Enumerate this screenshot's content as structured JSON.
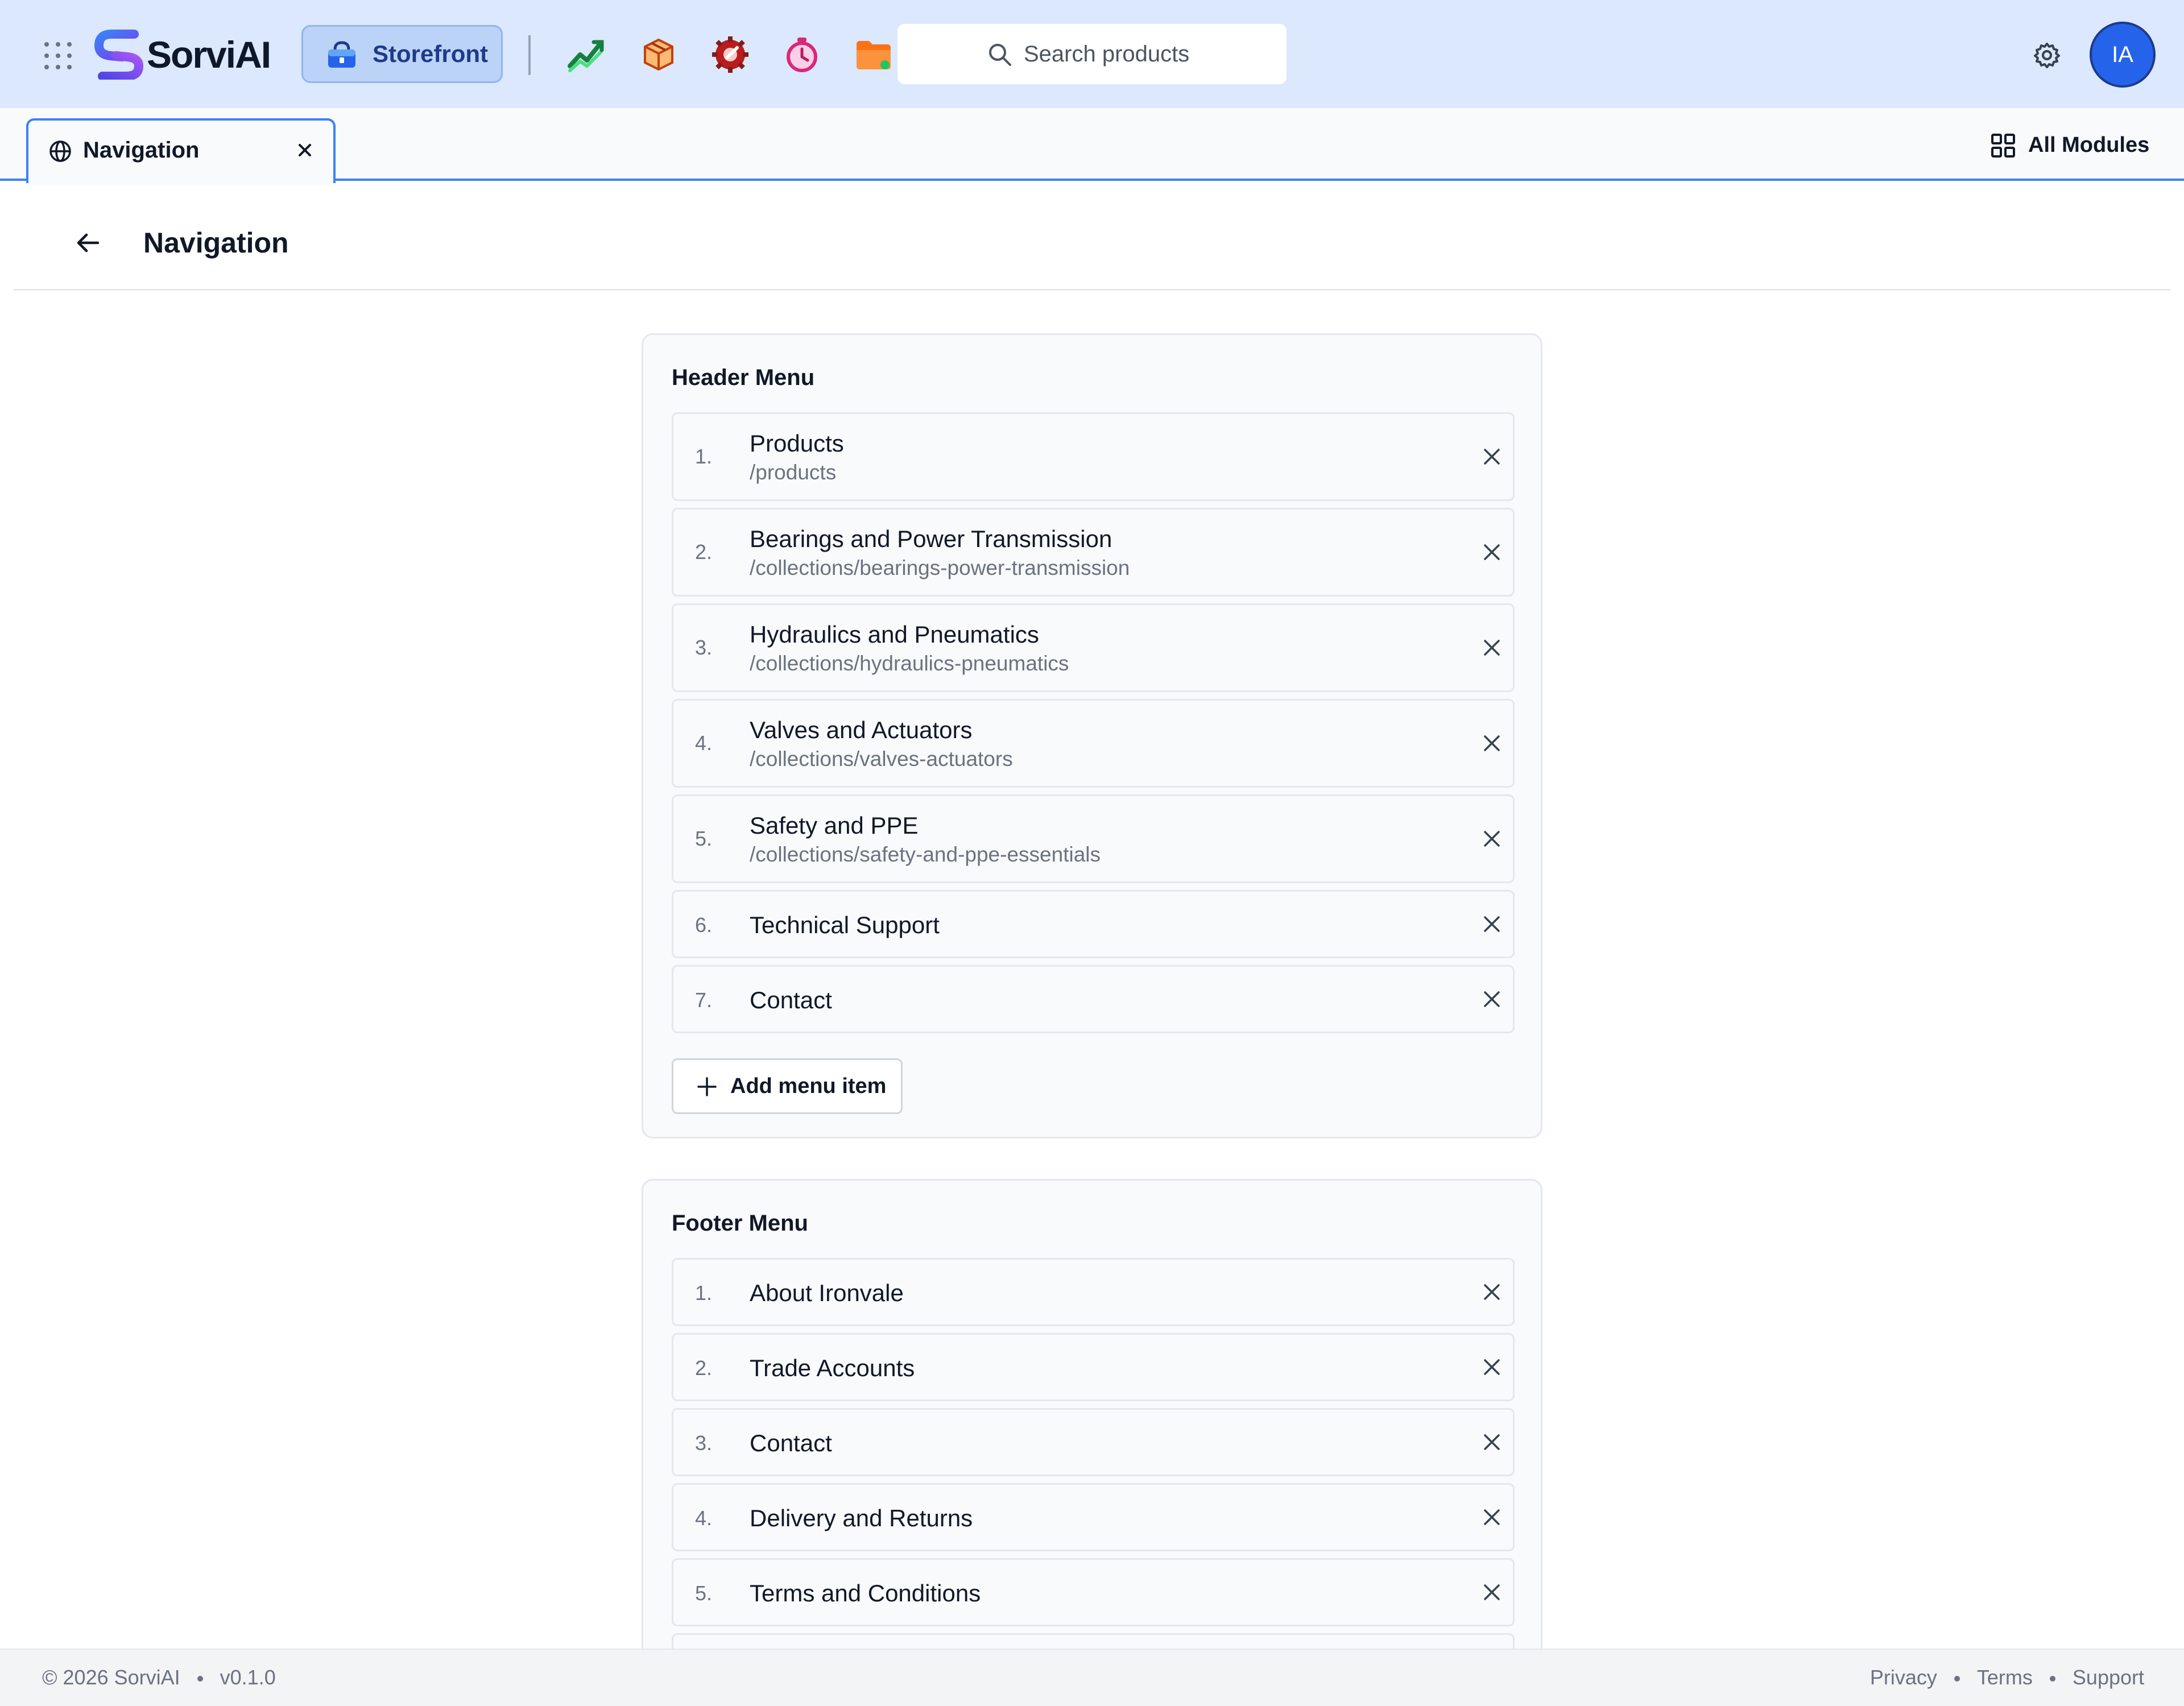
{
  "topbar": {
    "brand": "SorviAI",
    "active_module": "Storefront",
    "module_icons": [
      "analytics-icon",
      "orders-box-icon",
      "service-tools-icon",
      "timer-icon",
      "folder-icon"
    ],
    "search_placeholder": "Search products",
    "avatar_initials": "IA",
    "colors": {
      "bar_bg": "#dbe8fd",
      "avatar_bg": "#2563eb",
      "pill_bg": "#bcd3f8"
    }
  },
  "tabs": {
    "active_label": "Navigation",
    "all_modules_label": "All Modules"
  },
  "page": {
    "title": "Navigation"
  },
  "header_menu": {
    "title": "Header Menu",
    "items": [
      {
        "num": "1.",
        "title": "Products",
        "url": "/products"
      },
      {
        "num": "2.",
        "title": "Bearings and Power Transmission",
        "url": "/collections/bearings-power-transmission"
      },
      {
        "num": "3.",
        "title": "Hydraulics and Pneumatics",
        "url": "/collections/hydraulics-pneumatics"
      },
      {
        "num": "4.",
        "title": "Valves and Actuators",
        "url": "/collections/valves-actuators"
      },
      {
        "num": "5.",
        "title": "Safety and PPE",
        "url": "/collections/safety-and-ppe-essentials"
      },
      {
        "num": "6.",
        "title": "Technical Support"
      },
      {
        "num": "7.",
        "title": "Contact"
      }
    ],
    "add_label": "Add menu item"
  },
  "footer_menu": {
    "title": "Footer Menu",
    "items": [
      {
        "num": "1.",
        "title": "About Ironvale"
      },
      {
        "num": "2.",
        "title": "Trade Accounts"
      },
      {
        "num": "3.",
        "title": "Contact"
      },
      {
        "num": "4.",
        "title": "Delivery and Returns"
      },
      {
        "num": "5.",
        "title": "Terms and Conditions"
      }
    ]
  },
  "footer": {
    "copyright": "© 2026 SorviAI",
    "version": "v0.1.0",
    "links": [
      "Privacy",
      "Terms",
      "Support"
    ]
  }
}
